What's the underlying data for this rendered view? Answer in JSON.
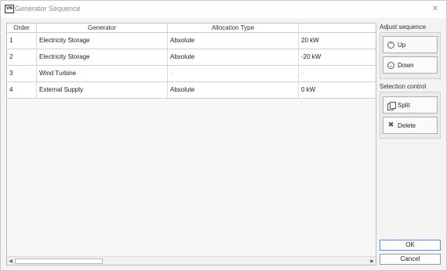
{
  "window": {
    "title": "Generator Sequence",
    "app_icon_text": "VN",
    "close_glyph": "✕"
  },
  "grid": {
    "columns": [
      "Order",
      "Generator",
      "Allocation Type",
      ""
    ],
    "rows": [
      {
        "order": "1",
        "generator": "Electricity Storage",
        "allocation_type": "Absolute",
        "value": "20 kW"
      },
      {
        "order": "2",
        "generator": "Electricity Storage",
        "allocation_type": "Absolute",
        "value": "-20 kW"
      },
      {
        "order": "3",
        "generator": "Wind Turbine",
        "allocation_type": "-",
        "value": "-"
      },
      {
        "order": "4",
        "generator": "External Supply",
        "allocation_type": "Absolute",
        "value": "0 kW"
      }
    ],
    "scroll_left_glyph": "◀",
    "scroll_right_glyph": "▶"
  },
  "adjust_sequence": {
    "label": "Adjust sequence",
    "up_label": "Up",
    "up_glyph": "⌃",
    "up_icon": "chevron-up-circle-icon",
    "down_label": "Down",
    "down_glyph": "⌄",
    "down_icon": "chevron-down-circle-icon"
  },
  "selection_control": {
    "label": "Selection control",
    "split_label": "Split",
    "split_icon": "split-copy-icon",
    "delete_label": "Delete",
    "delete_glyph": "✖",
    "delete_icon": "delete-x-icon"
  },
  "dialog_buttons": {
    "ok_label": "OK",
    "cancel_label": "Cancel"
  }
}
